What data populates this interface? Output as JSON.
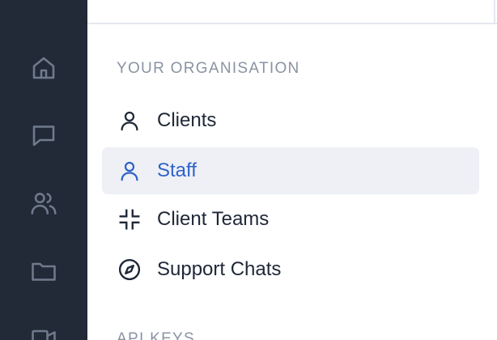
{
  "rail": {
    "items": [
      {
        "icon": "home-icon"
      },
      {
        "icon": "chat-bubble-icon"
      },
      {
        "icon": "users-icon"
      },
      {
        "icon": "folder-icon"
      },
      {
        "icon": "video-camera-icon"
      }
    ]
  },
  "nav": {
    "section_title": "YOUR ORGANISATION",
    "items": [
      {
        "label": "Clients",
        "icon": "user-icon",
        "active": false
      },
      {
        "label": "Staff",
        "icon": "user-icon",
        "active": true
      },
      {
        "label": "Client Teams",
        "icon": "collapse-arrows-icon",
        "active": false
      },
      {
        "label": "Support Chats",
        "icon": "compass-icon",
        "active": false
      }
    ],
    "next_section_title": "API KEYS"
  },
  "colors": {
    "rail_bg": "#222a37",
    "rail_icon": "#6f7a8c",
    "active_bg": "#eef0f6",
    "active_text": "#2f62c7",
    "text": "#1f2737",
    "heading": "#8a93a3"
  }
}
